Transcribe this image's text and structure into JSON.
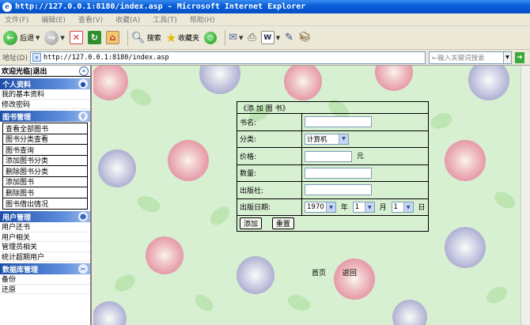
{
  "window": {
    "title": "http://127.0.0.1:8180/index.asp - Microsoft Internet Explorer"
  },
  "menu": [
    "文件(F)",
    "编辑(E)",
    "查看(V)",
    "收藏(A)",
    "工具(T)",
    "帮助(H)"
  ],
  "toolbar": {
    "back_label": "后退",
    "search_label": "搜索",
    "favorites_label": "收藏夹"
  },
  "address": {
    "label": "地址(D)",
    "url": "http://127.0.0.1:8180/index.asp",
    "keyword_placeholder": "←输入关键词搜索"
  },
  "sidebar": {
    "welcome": "欢迎光临",
    "logout": "退出",
    "collapse_icon": "«",
    "sections": [
      {
        "title": "个人资料",
        "icon": "person-icon",
        "items": [
          "我的基本资料",
          "修改密码"
        ]
      },
      {
        "title": "图书管理",
        "icon": "search-icon",
        "items": [
          "查看全部图书",
          "图书分类查看",
          "图书查询",
          "添加图书分类",
          "删除图书分类",
          "添加图书",
          "删除图书",
          "图书借出情况"
        ]
      },
      {
        "title": "用户管理",
        "icon": "users-icon",
        "items": [
          "用户还书",
          "用户相关",
          "管理员相关",
          "统计超期用户"
        ]
      },
      {
        "title": "数据库管理",
        "icon": "tools-icon",
        "items": [
          "备份",
          "还原"
        ]
      }
    ]
  },
  "form": {
    "caption": "《添 加 图 书》",
    "book_name_label": "书名:",
    "category_label": "分类:",
    "category_value": "计算机",
    "price_label": "价格:",
    "price_unit": "元",
    "quantity_label": "数量:",
    "publisher_label": "出版社:",
    "pubdate_label": "出版日期:",
    "year_value": "1970",
    "year_unit": "年",
    "month_value": "1",
    "month_unit": "月",
    "day_value": "1",
    "day_unit": "日",
    "add_button": "添加",
    "reset_button": "重置"
  },
  "pager": {
    "home": "首页",
    "back": "返回"
  },
  "colors": {
    "titlebar": "#0a5fd8",
    "sidebar_header": "#1c4fa8",
    "main_bg": "#d7f0d2"
  }
}
